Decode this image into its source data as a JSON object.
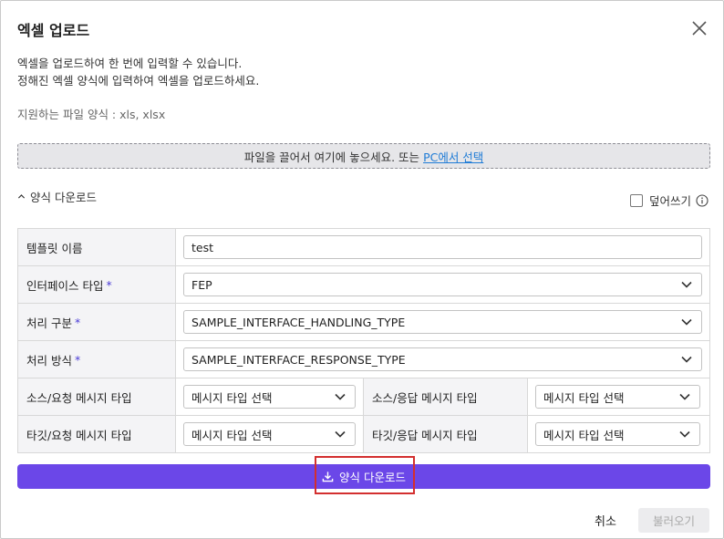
{
  "dialog": {
    "title": "엑셀 업로드",
    "description_line1": "엑셀을 업로드하여 한 번에 입력할 수 있습니다.",
    "description_line2": "정해진 엑셀 양식에 입력하여 엑셀을 업로드하세요.",
    "supported_formats": "지원하는 파일 양식 : xls, xlsx"
  },
  "dropzone": {
    "text": "파일을 끌어서 여기에 놓으세요. 또는",
    "link": "PC에서 선택"
  },
  "section": {
    "toggle_label": "양식 다운로드",
    "overwrite_label": "덮어쓰기"
  },
  "form": {
    "template_name": {
      "label": "템플릿 이름",
      "value": "test"
    },
    "interface_type": {
      "label": "인터페이스 타입",
      "required": "*",
      "value": "FEP"
    },
    "handling_type": {
      "label": "처리 구분",
      "required": "*",
      "value": "SAMPLE_INTERFACE_HANDLING_TYPE"
    },
    "response_type": {
      "label": "처리 방식",
      "required": "*",
      "value": "SAMPLE_INTERFACE_RESPONSE_TYPE"
    },
    "source_request_msg": {
      "label": "소스/요청 메시지 타입",
      "value": "메시지 타입 선택"
    },
    "source_response_msg": {
      "label": "소스/응답 메시지 타입",
      "value": "메시지 타입 선택"
    },
    "target_request_msg": {
      "label": "타깃/요청 메시지 타입",
      "value": "메시지 타입 선택"
    },
    "target_response_msg": {
      "label": "타깃/응답 메시지 타입",
      "value": "메시지 타입 선택"
    }
  },
  "buttons": {
    "download": "양식 다운로드",
    "cancel": "취소",
    "load": "불러오기"
  },
  "colors": {
    "primary": "#6b47e8",
    "link": "#1e7bd6",
    "highlight": "#d32f2f"
  }
}
